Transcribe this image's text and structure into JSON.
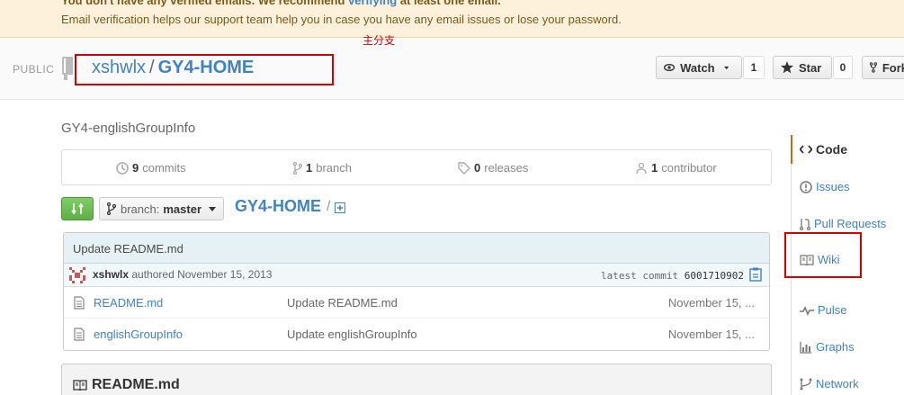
{
  "banner": {
    "line1_prefix": "You don't have any verified emails. We recommend",
    "line1_link": "verifying",
    "line1_suffix": "at least one email.",
    "line2": "Email verification helps our support team help you in case you have any email issues or lose your password."
  },
  "repo": {
    "visibility": "PUBLIC",
    "owner": "xshwlx",
    "separator": "/",
    "name": "GY4-HOME",
    "annotation": "主分支",
    "watch_label": "Watch",
    "watch_count": "1",
    "star_label": "Star",
    "star_count": "0",
    "fork_label": "Fork",
    "description": "GY4-englishGroupInfo"
  },
  "stats": {
    "commits_count": "9",
    "commits_label": "commits",
    "branch_count": "1",
    "branch_label": "branch",
    "releases_count": "0",
    "releases_label": "releases",
    "contributor_count": "1",
    "contributor_label": "contributor"
  },
  "nav": {
    "branch_prefix": "branch:",
    "branch_name": "master",
    "breadcrumb_repo": "GY4-HOME",
    "breadcrumb_sep": "/"
  },
  "commit": {
    "message": "Update README.md",
    "author": "xshwlx",
    "authored_text": "authored November 15, 2013",
    "latest_label": "latest commit",
    "sha": "6001710902"
  },
  "files": [
    {
      "name": "README.md",
      "message": "Update README.md",
      "date": "November 15, ..."
    },
    {
      "name": "englishGroupInfo",
      "message": "Update englishGroupInfo",
      "date": "November 15, ..."
    }
  ],
  "readme": {
    "title": "README.md"
  },
  "sidebar": {
    "items": [
      {
        "label": "Code"
      },
      {
        "label": "Issues"
      },
      {
        "label": "Pull Requests"
      },
      {
        "label": "Wiki"
      },
      {
        "label": "Pulse"
      },
      {
        "label": "Graphs"
      },
      {
        "label": "Network"
      }
    ]
  },
  "colors": {
    "link": "#4183c4",
    "annotation_red": "#d40000",
    "banner_bg": "#fdf1dc",
    "compare_green": "#6cc04a"
  }
}
